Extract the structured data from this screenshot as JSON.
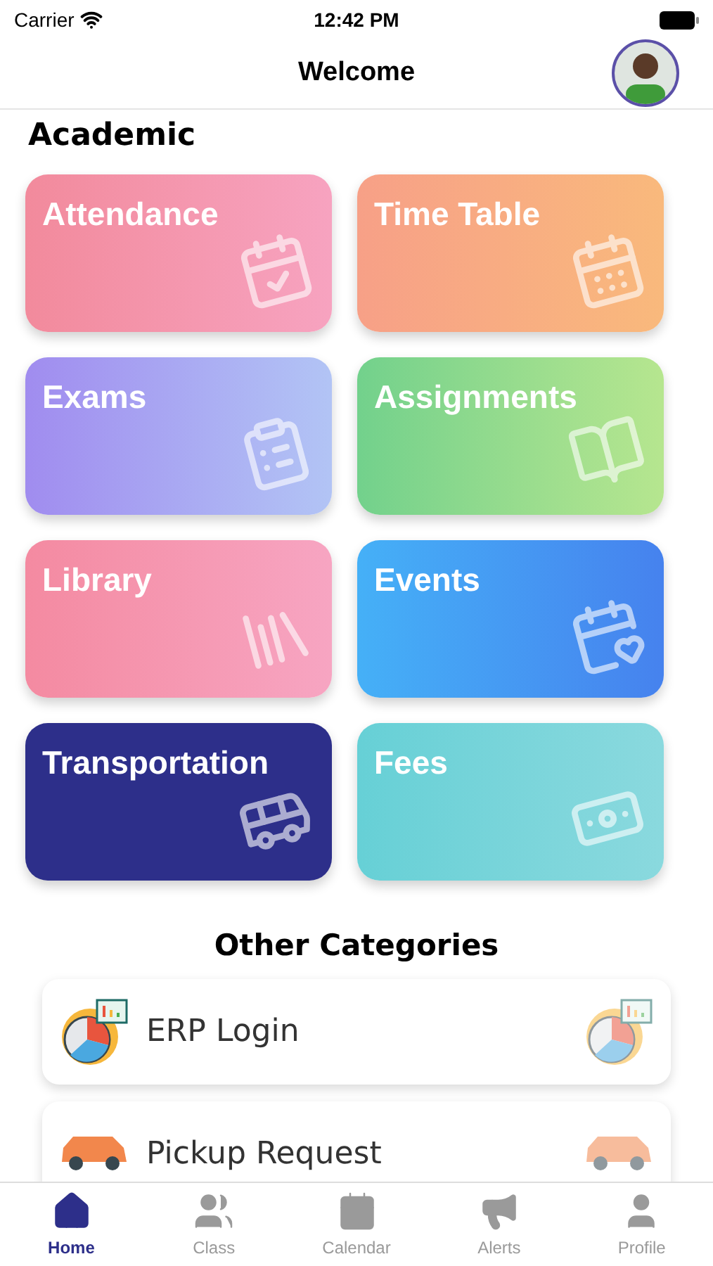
{
  "status_bar": {
    "carrier": "Carrier",
    "time": "12:42 PM"
  },
  "header": {
    "title": "Welcome"
  },
  "academic": {
    "title": "Academic",
    "tiles": [
      {
        "label": "Attendance"
      },
      {
        "label": "Time Table"
      },
      {
        "label": "Exams"
      },
      {
        "label": "Assignments"
      },
      {
        "label": "Library"
      },
      {
        "label": "Events"
      },
      {
        "label": "Transportation"
      },
      {
        "label": "Fees"
      }
    ]
  },
  "other_categories": {
    "title": "Other Categories",
    "items": [
      {
        "label": "ERP Login",
        "kind": "chart"
      },
      {
        "label": "Pickup Request",
        "kind": "car"
      }
    ]
  },
  "tab_bar": [
    {
      "label": "Home",
      "selected": true
    },
    {
      "label": "Class",
      "selected": false
    },
    {
      "label": "Calendar",
      "selected": false
    },
    {
      "label": "Alerts",
      "selected": false
    },
    {
      "label": "Profile",
      "selected": false
    }
  ]
}
